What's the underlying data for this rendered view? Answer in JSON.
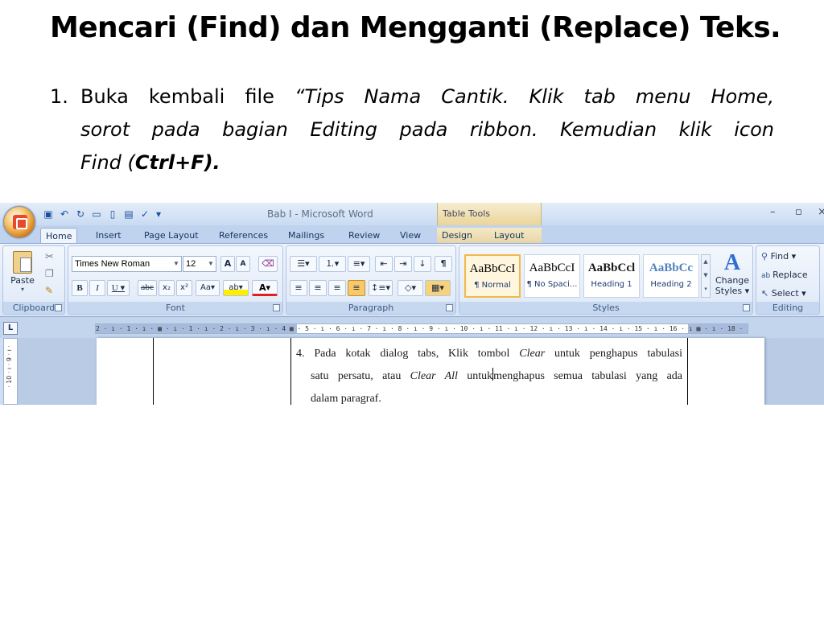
{
  "slide": {
    "title": "Mencari (Find) dan Mengganti (Replace) Teks.",
    "step_number": "1.",
    "step_lead": "Buka kembali file ",
    "step_italic": "“Tips Nama Cantik. Klik tab menu Home, sorot pada bagian Editing pada ribbon. Kemudian klik icon Find (",
    "step_italic_line1": "“Tips Nama Cantik. Klik tab menu Home,",
    "step_italic_line2": "sorot pada bagian Editing pada ribbon. Kemudian klik icon",
    "step_italic_line3": "Find (",
    "step_shortcut": "Ctrl+F).",
    "step_tail": ""
  },
  "word": {
    "window_title": "Bab I - Microsoft Word",
    "contextual_header": "Table Tools",
    "tabs": [
      "Home",
      "Insert",
      "Page Layout",
      "References",
      "Mailings",
      "Review",
      "View",
      "Design",
      "Layout"
    ],
    "active_tab": "Home",
    "groups": {
      "clipboard": {
        "name": "Clipboard",
        "paste": "Paste"
      },
      "font": {
        "name": "Font",
        "font_name": "Times New Roman",
        "font_size": "12"
      },
      "paragraph": {
        "name": "Paragraph"
      },
      "styles": {
        "name": "Styles",
        "items": [
          {
            "preview": "AaBbCcI",
            "label": "¶ Normal"
          },
          {
            "preview": "AaBbCcI",
            "label": "¶ No Spaci..."
          },
          {
            "preview": "AaBbCcl",
            "label": "Heading 1"
          },
          {
            "preview": "AaBbCc",
            "label": "Heading 2"
          }
        ],
        "change_styles_line1": "Change",
        "change_styles_line2": "Styles ▾"
      },
      "editing": {
        "name": "Editing",
        "find": "Find ▾",
        "replace": "Replace",
        "select": "Select ▾"
      }
    },
    "ruler_text": "2 · ı · 1 · ı · ▦  · ı · 1 · ı · 2 · ı · 3 · ı · 4 ▦ · 5 · ı · 6 · ı · 7 · ı · 8 · ı · 9 · ı · 10 · ı · 11 · ı · 12 · ı · 13 · ı · 14 · ı · 15 · ı · 16 · ı ▦ · ı · 18 · ı ·",
    "vruler_text": "· 10 · ı · 9 · ı ·",
    "document": {
      "line1": "4. Pada kotak dialog tabs, Klik tombol Clear untuk penghapus tabulasi",
      "line1_pre": "4. Pada kotak dialog tabs, Klik tombol ",
      "line1_italic": "Clear",
      "line1_post": " untuk penghapus tabulasi",
      "line2_pre": "satu persatu, atau ",
      "line2_italic": "Clear All",
      "line2_mid": " untuk",
      "line2_post": "menghapus semua tabulasi yang ada",
      "line3": "dalam paragraf."
    }
  }
}
